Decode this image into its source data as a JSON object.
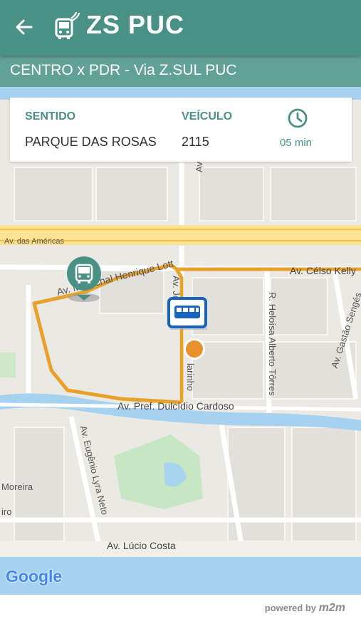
{
  "app": {
    "title": "ZS PUC"
  },
  "route": {
    "name": "CENTRO x PDR - Via Z.SUL PUC"
  },
  "info": {
    "direction_label": "SENTIDO",
    "direction_value": "PARQUE DAS ROSAS",
    "vehicle_label": "VEÍCULO",
    "vehicle_value": "2115",
    "eta": "05 min"
  },
  "map": {
    "streets": {
      "americas": "Av. das Américas",
      "celso_kelly": "Av. Célso Kelly",
      "marechal": "Av. Marechal Henrique Lott",
      "jo_marinho_a": "Av. Jo",
      "jo_marinho_b": "larinho",
      "heloisa": "R. Heloísa Alberto Tôrres",
      "gastao": "Av. Gastão Sengés",
      "dulcidio": "Av. Pref. Dulcídio Cardoso",
      "eugenio": "Av. Eugênio Lyra Neto",
      "lucio": "Av. Lúcio Costa",
      "moreira": "Moreira",
      "iro": "iro",
      "av_ti": "Av. Ti"
    },
    "attribution": "Google"
  },
  "footer": {
    "powered_by": "powered by",
    "brand": "m2m"
  },
  "colors": {
    "primary": "#4a9185",
    "route": "#e8a22c",
    "bus_blue": "#1565c0",
    "vehicle": "#e8902c"
  }
}
